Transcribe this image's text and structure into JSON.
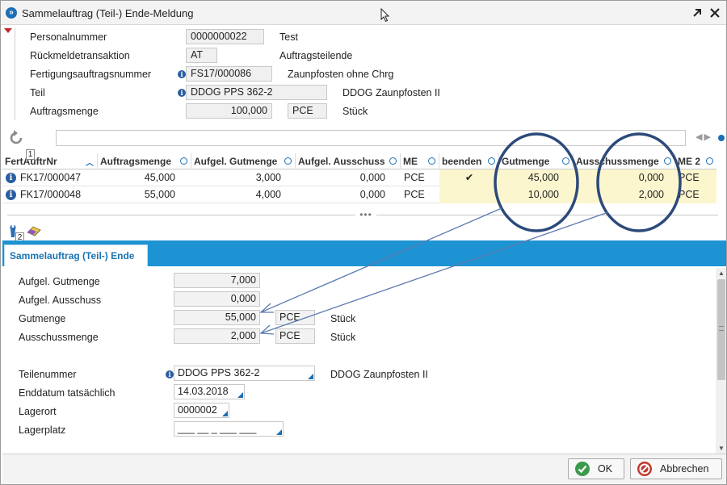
{
  "window": {
    "title": "Sammelauftrag (Teil-) Ende-Meldung"
  },
  "icons": {
    "app": "app-logo-icon",
    "maximize": "arrow-expand-icon",
    "close": "close-icon",
    "refresh": "refresh-icon",
    "wrench": "wrench-icon",
    "eraser": "eraser-icon",
    "ok": "check-icon",
    "cancel": "cancel-icon"
  },
  "colors": {
    "accent": "#1e93d3",
    "info": "#2a5d9f",
    "highlight": "#fcf6cf",
    "annotation": "#2c4a7a",
    "ok_green": "#3d9a4d",
    "cancel_red": "#c23a2e"
  },
  "header": {
    "personalnummer": {
      "label": "Personalnummer",
      "value": "0000000022",
      "desc": "Test"
    },
    "rueckmeldetransaktion": {
      "label": "Rückmeldetransaktion",
      "value": "AT",
      "desc": "Auftragsteilende"
    },
    "fertigungsauftrag": {
      "label": "Fertigungsauftragsnummer",
      "value": "FS17/000086",
      "desc": "Zaunpfosten ohne Chrg"
    },
    "teil": {
      "label": "Teil",
      "value": "DDOG PPS 362-2",
      "desc": "DDOG Zaunpfosten II"
    },
    "auftragsmenge": {
      "label": "Auftragsmenge",
      "value": "100,000",
      "unit": "PCE",
      "desc": "Stück"
    }
  },
  "grid": {
    "badge": "1",
    "columns": [
      "FertAuftrNr",
      "Auftragsmenge",
      "Aufgel. Gutmenge",
      "Aufgel. Ausschuss",
      "ME",
      "beenden",
      "Gutmenge",
      "Ausschussmenge",
      "ME 2"
    ],
    "rows": [
      {
        "nr": "FK17/000047",
        "auftragsmenge": "45,000",
        "aufgel_gut": "3,000",
        "aufgel_aus": "0,000",
        "me": "PCE",
        "beenden": "✔",
        "gutmenge": "45,000",
        "ausschuss": "0,000",
        "me2": "PCE"
      },
      {
        "nr": "FK17/000048",
        "auftragsmenge": "55,000",
        "aufgel_gut": "4,000",
        "aufgel_aus": "0,000",
        "me": "PCE",
        "beenden": "",
        "gutmenge": "10,000",
        "ausschuss": "2,000",
        "me2": "PCE"
      }
    ]
  },
  "splitter": {
    "dots": "•••"
  },
  "tools": {
    "badge": "2"
  },
  "tab": {
    "label": "Sammelauftrag (Teil-) Ende"
  },
  "detail": {
    "aufgel_gutmenge": {
      "label": "Aufgel. Gutmenge",
      "value": "7,000"
    },
    "aufgel_ausschuss": {
      "label": "Aufgel. Ausschuss",
      "value": "0,000"
    },
    "gutmenge": {
      "label": "Gutmenge",
      "value": "55,000",
      "unit": "PCE",
      "desc": "Stück"
    },
    "ausschussmenge": {
      "label": "Ausschussmenge",
      "value": "2,000",
      "unit": "PCE",
      "desc": "Stück"
    },
    "teilenummer": {
      "label": "Teilenummer",
      "value": "DDOG PPS 362-2",
      "desc": "DDOG Zaunpfosten II"
    },
    "enddatum": {
      "label": "Enddatum tatsächlich",
      "value": "14.03.2018"
    },
    "lagerort": {
      "label": "Lagerort",
      "value": "0000002"
    },
    "lagerplatz": {
      "label": "Lagerplatz",
      "value": "___ __ _ ___ ___"
    }
  },
  "buttons": {
    "ok": "OK",
    "cancel": "Abbrechen"
  }
}
